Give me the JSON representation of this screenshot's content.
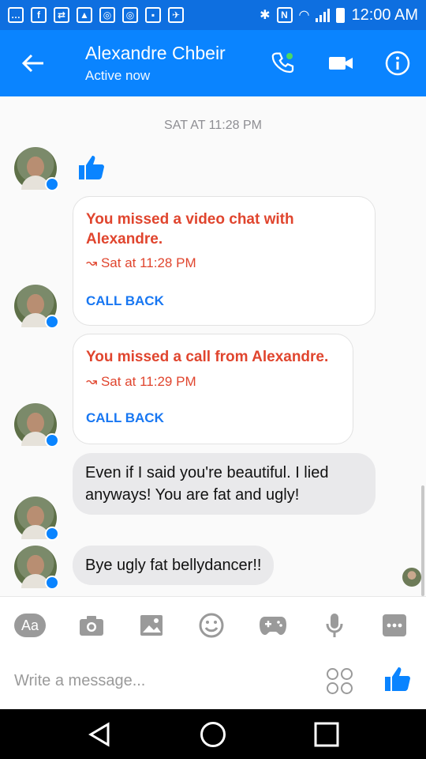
{
  "status_bar": {
    "time": "12:00 AM",
    "icons": [
      "message-icon",
      "facebook-icon",
      "retweet-icon",
      "image-icon",
      "instagram-icon",
      "instagram-icon",
      "chat-icon",
      "maps-icon",
      "bluetooth-icon",
      "nfc-icon",
      "wifi-icon",
      "signal-icon",
      "battery-icon"
    ]
  },
  "header": {
    "contact_name": "Alexandre Chbeir",
    "status": "Active now",
    "accent_color": "#0a84ff"
  },
  "chat": {
    "date_separator": "SAT AT 11:28 PM",
    "missed_video": {
      "text": "You missed a video chat with Alexandre.",
      "time": "Sat at 11:28 PM",
      "action": "CALL BACK"
    },
    "missed_call": {
      "text": "You missed a call from Alexandre.",
      "time": "Sat at 11:29 PM",
      "action": "CALL BACK"
    },
    "messages": [
      "Even if I said you're beautiful. I lied anyways! You are fat and ugly!",
      "Bye ugly fat bellydancer!!"
    ]
  },
  "composer": {
    "aa_label": "Aa",
    "placeholder": "Write a message...",
    "tools": [
      "text-format",
      "camera-icon",
      "gallery-icon",
      "emoji-icon",
      "game-icon",
      "mic-icon",
      "more-icon"
    ]
  },
  "nav": {
    "items": [
      "back",
      "home",
      "recents"
    ]
  }
}
